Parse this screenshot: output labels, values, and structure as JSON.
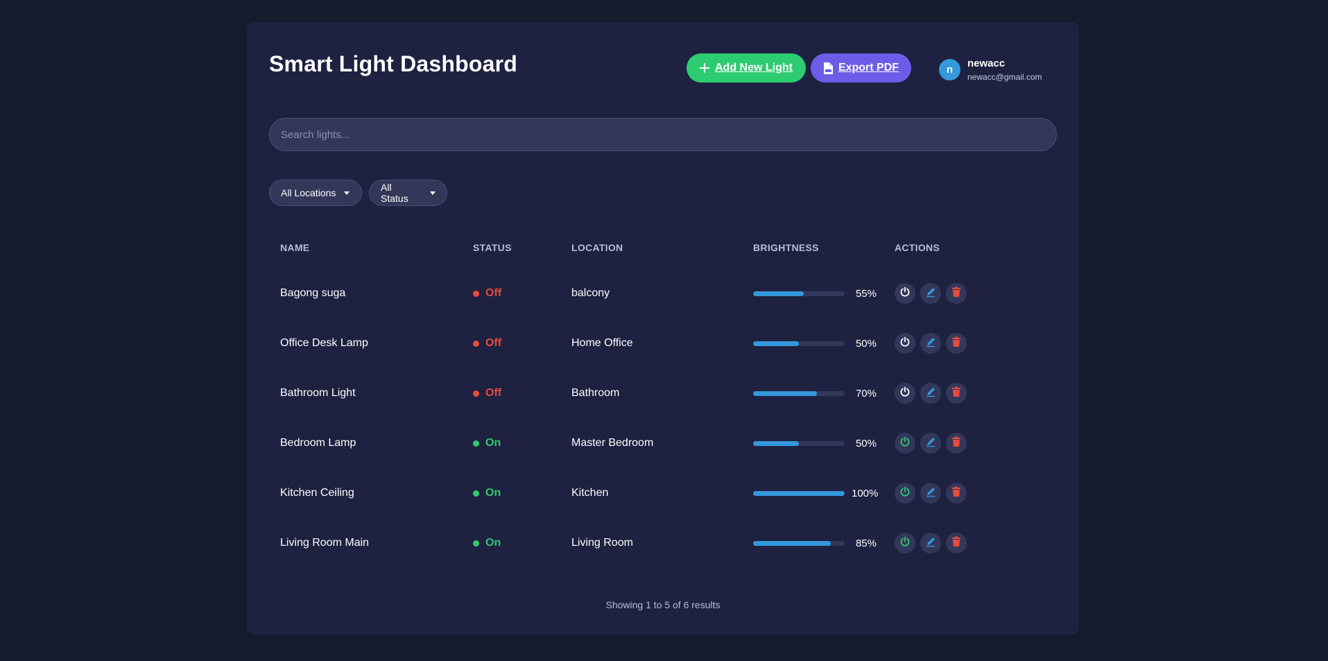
{
  "header": {
    "title": "Smart Light Dashboard",
    "add_label": "Add New Light",
    "export_label": "Export PDF"
  },
  "user": {
    "initial": "n",
    "name": "newacc",
    "email": "newacc@gmail.com"
  },
  "search": {
    "placeholder": "Search lights..."
  },
  "filters": {
    "location": "All Locations",
    "status": "All Status"
  },
  "table": {
    "columns": [
      "NAME",
      "STATUS",
      "LOCATION",
      "BRIGHTNESS",
      "ACTIONS"
    ],
    "rows": [
      {
        "name": "Bagong suga",
        "status": "Off",
        "location": "balcony",
        "brightness": 55,
        "brightness_label": "55%"
      },
      {
        "name": "Office Desk Lamp",
        "status": "Off",
        "location": "Home Office",
        "brightness": 50,
        "brightness_label": "50%"
      },
      {
        "name": "Bathroom Light",
        "status": "Off",
        "location": "Bathroom",
        "brightness": 70,
        "brightness_label": "70%"
      },
      {
        "name": "Bedroom Lamp",
        "status": "On",
        "location": "Master Bedroom",
        "brightness": 50,
        "brightness_label": "50%"
      },
      {
        "name": "Kitchen Ceiling",
        "status": "On",
        "location": "Kitchen",
        "brightness": 100,
        "brightness_label": "100%"
      },
      {
        "name": "Living Room Main",
        "status": "On",
        "location": "Living Room",
        "brightness": 85,
        "brightness_label": "85%"
      }
    ]
  },
  "footer": {
    "text": "Showing 1 to 5 of 6 results"
  },
  "colors": {
    "on": "#2ecc71",
    "off": "#e74c3c",
    "accent": "#3498db",
    "export": "#6c5ce7"
  },
  "icons": {
    "add": "plus-icon",
    "export": "pdf-file-icon",
    "toggle": "power-icon",
    "edit": "pencil-icon",
    "delete": "trash-icon"
  }
}
